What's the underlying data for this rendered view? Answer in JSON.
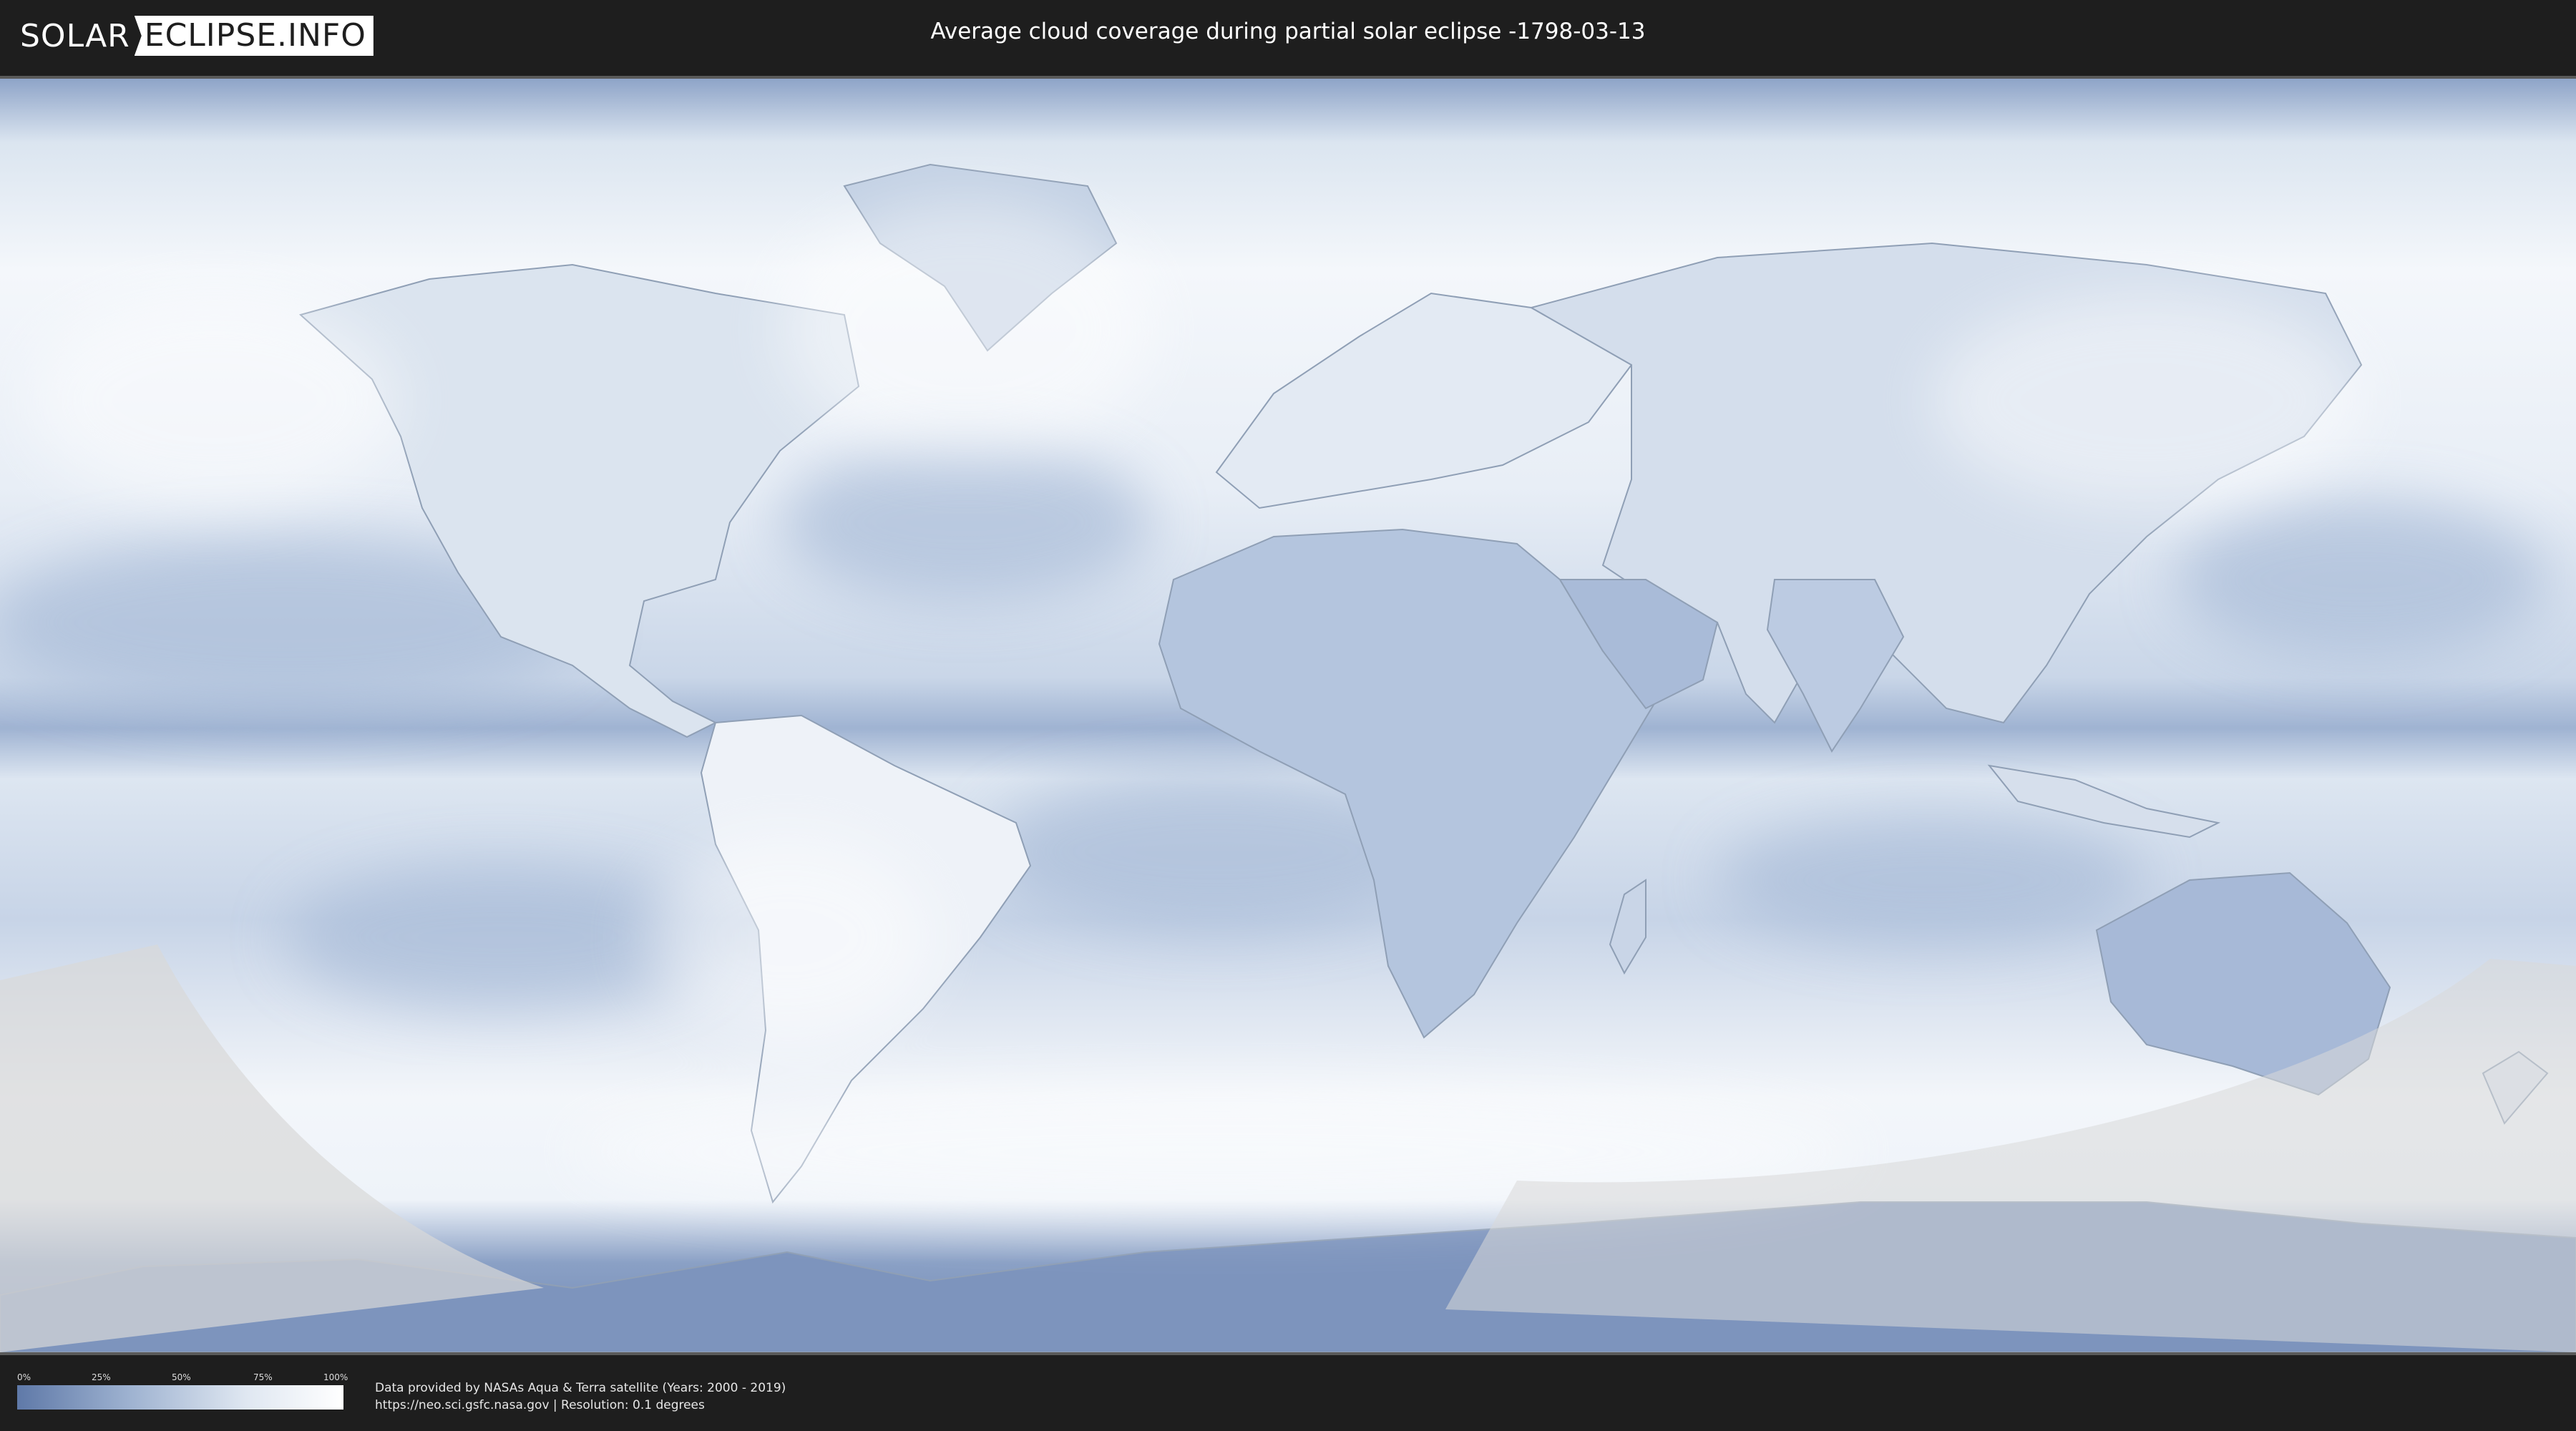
{
  "header": {
    "logo_left": "SOLAR",
    "logo_right": "ECLIPSE.INFO",
    "title": "Average cloud coverage during partial solar eclipse -1798-03-13"
  },
  "legend": {
    "ticks": [
      "0%",
      "25%",
      "50%",
      "75%",
      "100%"
    ],
    "colors": {
      "low": "#5f79a8",
      "mid": "#9fb3d1",
      "high": "#ffffff"
    }
  },
  "credits": {
    "line1": "Data provided by NASAs Aqua & Terra satellite (Years: 2000 - 2019)",
    "line2": "https://neo.sci.gsfc.nasa.gov | Resolution: 0.1 degrees"
  },
  "colors": {
    "background": "#1e1e1e",
    "cloud_clear": "#6e88b6",
    "cloud_full": "#ffffff",
    "eclipse_shadow": "#d9d9d9"
  }
}
